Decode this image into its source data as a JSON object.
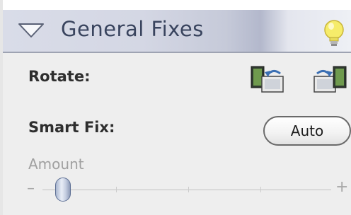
{
  "panel": {
    "title": "General Fixes",
    "rotate_label": "Rotate:",
    "smart_fix_label": "Smart Fix:",
    "auto_button_label": "Auto",
    "amount_label": "Amount",
    "slider_min_symbol": "–",
    "slider_max_symbol": "+",
    "amount_value_fraction": 0.07
  },
  "icons": {
    "disclosure": "disclosure-triangle-icon",
    "tip": "lightbulb-icon",
    "rotate_left": "rotate-left-icon",
    "rotate_right": "rotate-right-icon"
  },
  "colors": {
    "title_text": "#39445e",
    "header_bg": "#d4d7e4",
    "panel_bg": "#eeeeee",
    "bulb": "#f6ec6a"
  }
}
